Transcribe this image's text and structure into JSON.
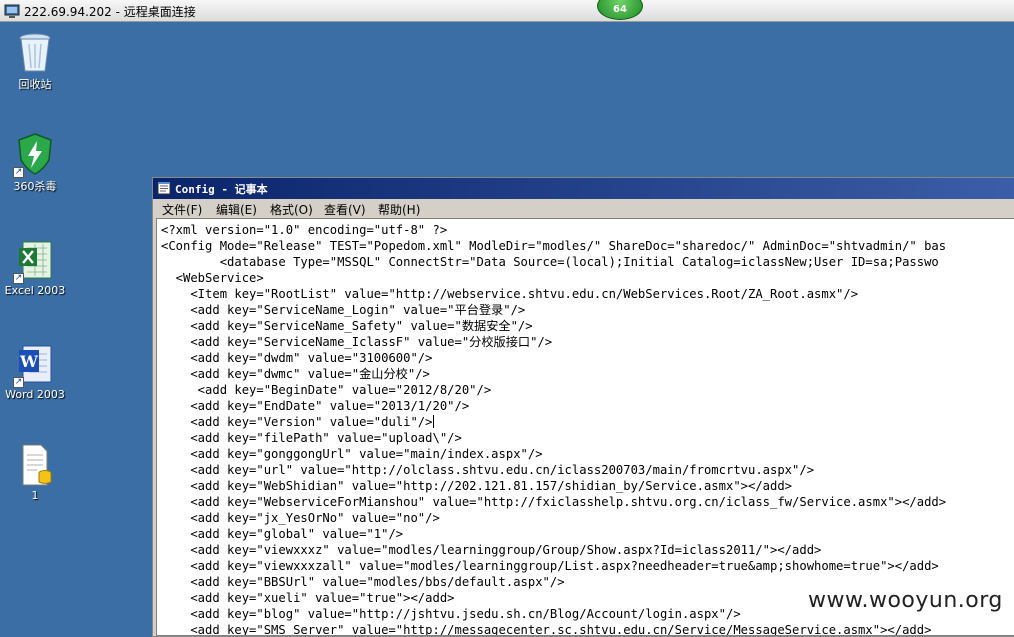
{
  "remote_desktop": {
    "title": "222.69.94.202 - 远程桌面连接",
    "badge": "64"
  },
  "desktop_icons": [
    {
      "label": "回收站",
      "icon": "recycle-bin-icon"
    },
    {
      "label": "360杀毒",
      "icon": "shield-icon"
    },
    {
      "label": "Excel 2003",
      "icon": "excel-icon"
    },
    {
      "label": "Word 2003",
      "icon": "word-icon"
    },
    {
      "label": "1",
      "icon": "document-icon"
    }
  ],
  "notepad": {
    "title": "Config - 记事本",
    "menu": [
      "文件(F)",
      "编辑(E)",
      "格式(O)",
      "查看(V)",
      "帮助(H)"
    ],
    "lines": [
      "<?xml version=\"1.0\" encoding=\"utf-8\" ?>",
      "<Config Mode=\"Release\" TEST=\"Popedom.xml\" ModleDir=\"modles/\" ShareDoc=\"sharedoc/\" AdminDoc=\"shtvadmin/\" bas",
      "        <database Type=\"MSSQL\" ConnectStr=\"Data Source=(local);Initial Catalog=iclassNew;User ID=sa;Passwo",
      "  <WebService>",
      "    <Item key=\"RootList\" value=\"http://webservice.shtvu.edu.cn/WebServices.Root/ZA_Root.asmx\"/>",
      "    <add key=\"ServiceName_Login\" value=\"平台登录\"/>",
      "    <add key=\"ServiceName_Safety\" value=\"数据安全\"/>",
      "    <add key=\"ServiceName_IclassF\" value=\"分校版接口\"/>",
      "    <add key=\"dwdm\" value=\"3100600\"/>",
      "    <add key=\"dwmc\" value=\"金山分校\"/>",
      "     <add key=\"BeginDate\" value=\"2012/8/20\"/>",
      "    <add key=\"EndDate\" value=\"2013/1/20\"/>",
      "    <add key=\"Version\" value=\"duli\"/>",
      "    <add key=\"filePath\" value=\"upload\\\"/>",
      "    <add key=\"gonggongUrl\" value=\"main/index.aspx\"/>",
      "    <add key=\"url\" value=\"http://olclass.shtvu.edu.cn/iclass200703/main/fromcrtvu.aspx\"/>",
      "    <add key=\"WebShidian\" value=\"http://202.121.81.157/shidian_by/Service.asmx\"></add>",
      "    <add key=\"WebserviceForMianshou\" value=\"http://fxiclasshelp.shtvu.org.cn/iclass_fw/Service.asmx\"></add>",
      "    <add key=\"jx_YesOrNo\" value=\"no\"/>",
      "    <add key=\"global\" value=\"1\"/>",
      "    <add key=\"viewxxxz\" value=\"modles/learninggroup/Group/Show.aspx?Id=iclass2011/\"></add>",
      "    <add key=\"viewxxxzall\" value=\"modles/learninggroup/List.aspx?needheader=true&amp;showhome=true\"></add>",
      "    <add key=\"BBSUrl\" value=\"modles/bbs/default.aspx\"/>",
      "    <add key=\"xueli\" value=\"true\"></add>",
      "    <add key=\"blog\" value=\"http://jshtvu.jsedu.sh.cn/Blog/Account/login.aspx\"/>",
      "    <add key=\"SMS_Server\" value=\"http://messagecenter.sc.shtvu.edu.cn/Service/MessageService.asmx\"></add>"
    ]
  },
  "watermark": "www.wooyun.org"
}
